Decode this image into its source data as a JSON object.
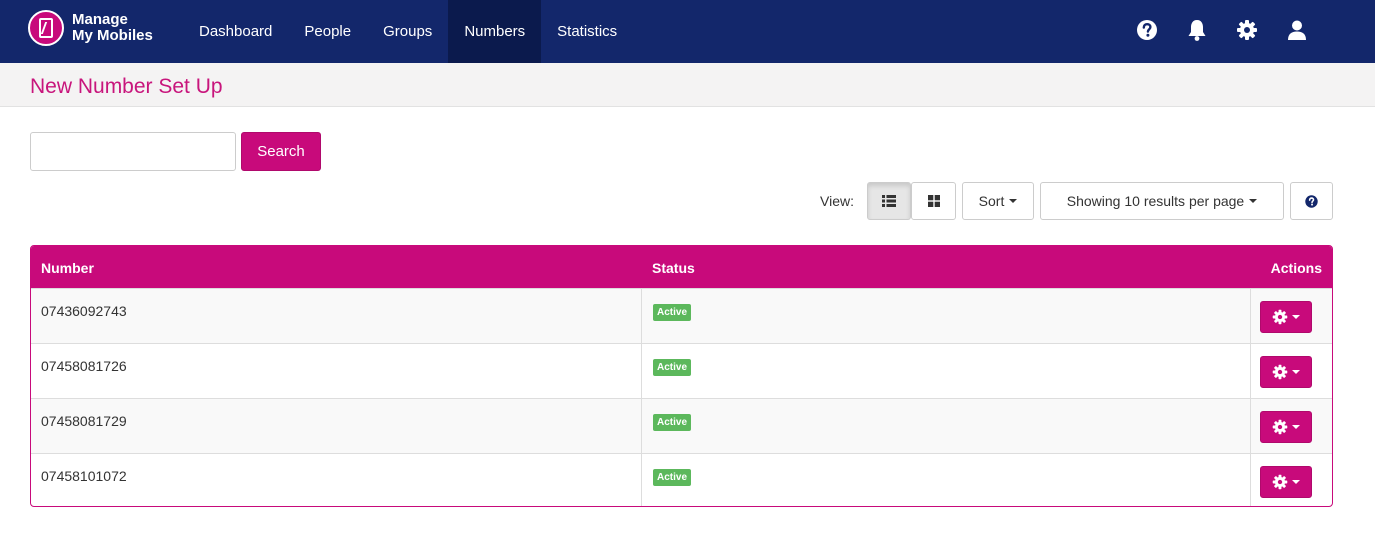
{
  "app": {
    "logo_line1": "Manage",
    "logo_line2": "My Mobiles"
  },
  "nav": {
    "items": [
      {
        "label": "Dashboard",
        "active": false
      },
      {
        "label": "People",
        "active": false
      },
      {
        "label": "Groups",
        "active": false
      },
      {
        "label": "Numbers",
        "active": true
      },
      {
        "label": "Statistics",
        "active": false
      }
    ],
    "icons": [
      "help-icon",
      "bell-icon",
      "gear-icon",
      "user-icon"
    ]
  },
  "page": {
    "title": "New Number Set Up"
  },
  "search": {
    "value": "",
    "button_label": "Search"
  },
  "toolbar": {
    "view_label": "View:",
    "view_modes": [
      "list-view-icon",
      "grid-view-icon"
    ],
    "active_view": "list",
    "sort_label": "Sort",
    "per_page_label": "Showing 10 results per page",
    "help_icon": "help-icon"
  },
  "table": {
    "columns": [
      "Number",
      "Status",
      "Actions"
    ],
    "rows": [
      {
        "number": "07436092743",
        "status": "Active"
      },
      {
        "number": "07458081726",
        "status": "Active"
      },
      {
        "number": "07458081729",
        "status": "Active"
      },
      {
        "number": "07458101072",
        "status": "Active"
      }
    ]
  },
  "colors": {
    "nav_bg": "#13276b",
    "accent": "#c80a7b",
    "status_active": "#5cb85c"
  }
}
